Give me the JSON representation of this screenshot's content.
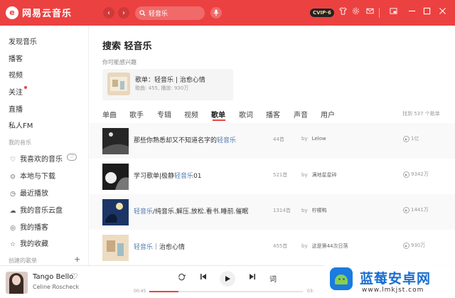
{
  "app": {
    "name": "网易云音乐",
    "logo_glyph": "e",
    "accent": "#ec4141"
  },
  "titlebar": {
    "back_icon": "‹",
    "forward_icon": "›",
    "search_value": "轻音乐",
    "vip_badge": "CVIP·6",
    "icons": [
      "shirt-icon",
      "gear-icon",
      "mail-icon",
      "mini-mode-icon",
      "minimize-icon",
      "maximize-icon",
      "close-icon"
    ]
  },
  "sidebar": {
    "top_items": [
      {
        "label": "发现音乐"
      },
      {
        "label": "播客"
      },
      {
        "label": "视频"
      },
      {
        "label": "关注",
        "dot": true
      },
      {
        "label": "直播"
      },
      {
        "label": "私人FM"
      }
    ],
    "my_music_header": "我的音乐",
    "my_music": [
      {
        "label": "我喜欢的音乐",
        "icon": "♡"
      },
      {
        "label": "本地与下载",
        "icon": "⊙"
      },
      {
        "label": "最近播放",
        "icon": "◷"
      },
      {
        "label": "我的音乐云盘",
        "icon": "☁"
      },
      {
        "label": "我的播客",
        "icon": "◎"
      },
      {
        "label": "我的收藏",
        "icon": "☆"
      }
    ],
    "created_header": "创建的歌单",
    "created_add": "+"
  },
  "main": {
    "title": "搜索 轻音乐",
    "suggest_header": "你可能感兴趣",
    "suggest": {
      "title": "歌单：轻音乐 | 治愈心情",
      "sub": "歌曲: 455, 播放: 930万"
    },
    "tabs": [
      "单曲",
      "歌手",
      "专辑",
      "视频",
      "歌单",
      "歌词",
      "播客",
      "声音",
      "用户"
    ],
    "active_tab": "歌单",
    "result_count": "找到 537 个歌单",
    "rows": [
      {
        "pre": "那些你熟悉却又不知道名字的",
        "hl": "轻音乐",
        "post": "",
        "count": "44首",
        "by": "by",
        "creator": "Lelow",
        "plays": "1亿"
      },
      {
        "pre": "学习歌单|极静",
        "hl": "轻音乐",
        "post": "01",
        "count": "521首",
        "by": "by",
        "creator": "满地星星碎",
        "plays": "9342万"
      },
      {
        "pre": "",
        "hl": "轻音乐",
        "post": "/纯音乐.解压.放松.看书.睡前.催眠",
        "count": "1314首",
        "by": "by",
        "creator": "柠檬鸭",
        "plays": "1441万"
      },
      {
        "pre": "",
        "hl": "轻音乐",
        "post": "｜治愈心情",
        "count": "455首",
        "by": "by",
        "creator": "这是第44次日落",
        "plays": "930万"
      }
    ]
  },
  "player": {
    "title": "Tango Bello",
    "artist": "Celine Roscheck",
    "elapsed": "00:45",
    "total": "03:",
    "progress": 0.19,
    "lyric_btn": "词"
  },
  "watermark": {
    "title": "蓝莓安卓网",
    "url": "www.lmkjst.com"
  }
}
